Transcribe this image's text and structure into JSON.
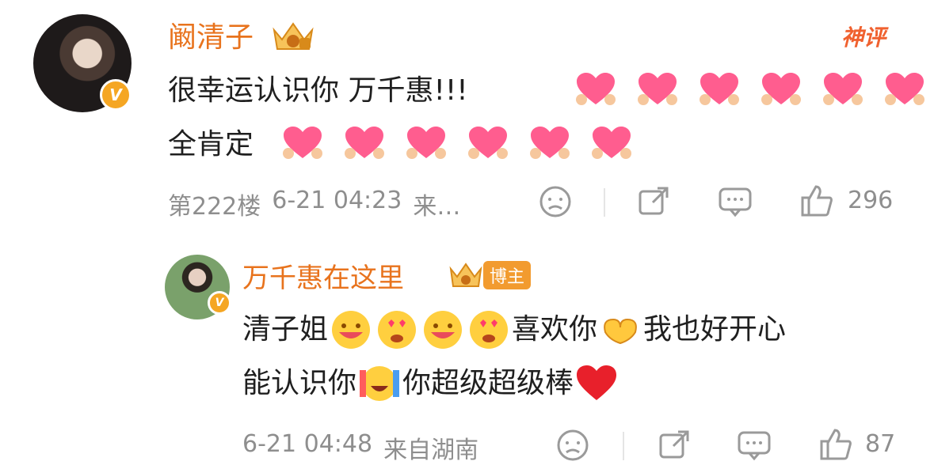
{
  "comment": {
    "username": "阚清子",
    "badge_label": "神评",
    "text_line1": "很幸运认识你 万千惠!!!",
    "text_line2": "全肯定",
    "floor": "第222楼",
    "time": "6-21 04:23",
    "location_truncated": "来…",
    "likes": "296",
    "icons": [
      "angry-icon",
      "share-icon",
      "comment-icon",
      "like-icon"
    ]
  },
  "reply": {
    "username": "万千惠在这里",
    "tag": "博主",
    "text_a": "清子姐",
    "text_b": "喜欢你",
    "text_c": "我也好开心",
    "text_d": "能认识你",
    "text_e": "你超级超级棒",
    "time": "6-21 04:48",
    "location": "来自湖南",
    "likes": "87"
  },
  "colors": {
    "username": "#e8731d",
    "meta_text": "#8e8e8e",
    "verified_badge": "#f5a623",
    "heart": "#ff5d8f"
  }
}
